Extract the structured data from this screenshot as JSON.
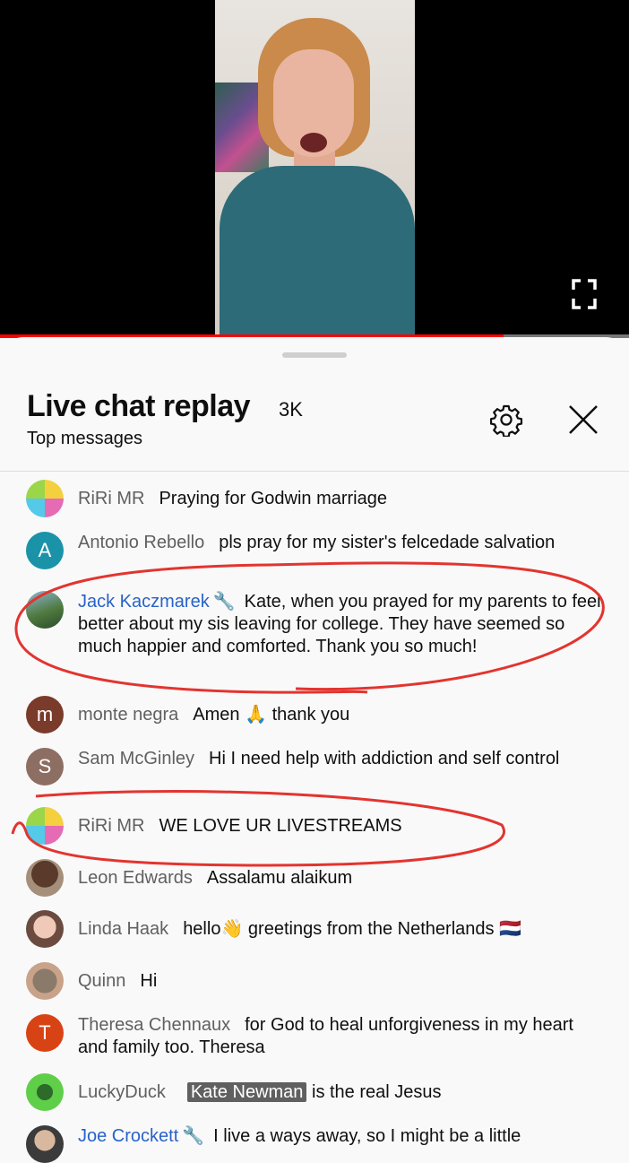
{
  "chat": {
    "title": "Live chat replay",
    "count": "3K",
    "subtitle": "Top messages"
  },
  "messages": [
    {
      "author": "RiRi MR",
      "text": "Praying for Godwin marriage"
    },
    {
      "author": "Antonio Rebello",
      "initial": "A",
      "text": "pls pray for my sister's felcedade salvation"
    },
    {
      "author": "Jack Kaczmarek",
      "text": "Kate, when you prayed for my parents to feel better about my sis leaving for college. They have seemed so much happier and comforted. Thank you so much!"
    },
    {
      "author": "monte negra",
      "initial": "m",
      "text_before": "Amen",
      "emoji": "🙏",
      "text_after": "thank you"
    },
    {
      "author": "Sam McGinley",
      "initial": "S",
      "text": "Hi I need help with addiction and self control"
    },
    {
      "author": "RiRi MR",
      "text": "WE LOVE UR LIVESTREAMS"
    },
    {
      "author": "Leon Edwards",
      "text": "Assalamu alaikum"
    },
    {
      "author": "Linda Haak",
      "text_before": "hello",
      "emoji": "👋",
      "text_after": "greetings from the Netherlands 🇳🇱"
    },
    {
      "author": "Quinn",
      "text": "Hi"
    },
    {
      "author": "Theresa Chennaux",
      "initial": "T",
      "text": "for God to heal unforgiveness in my heart and family too. Theresa"
    },
    {
      "author": "LuckyDuck",
      "mention": "Kate Newman",
      "text": "is the real Jesus"
    },
    {
      "author": "Joe Crockett",
      "text": "I live a ways away, so I might be a little"
    }
  ],
  "progress": {
    "played_fraction": 0.8
  },
  "colors": {
    "owner_name": "#2962c8",
    "annotation": "#e3342f"
  }
}
